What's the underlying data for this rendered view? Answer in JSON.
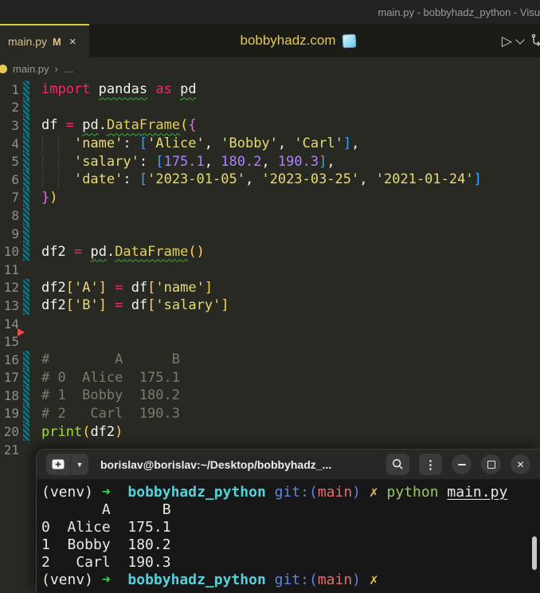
{
  "window": {
    "titlebar_text": "main.py - bobbyhadz_python - Visu"
  },
  "tab_bar": {
    "tab": {
      "name": "main.py",
      "modified_badge": "M",
      "close_glyph": "×"
    },
    "center_title": {
      "text": "bobbyhadz.com",
      "emoji": "🧊"
    },
    "actions": {
      "run_glyph": "▷"
    }
  },
  "breadcrumb": {
    "file": "main.py",
    "separator": "›",
    "more": "…"
  },
  "editor": {
    "deleted_marker_after_line": 14,
    "lines": [
      {
        "n": 1,
        "g": "m",
        "t": [
          [
            "import",
            "kw"
          ],
          [
            " ",
            "pl"
          ],
          [
            "pandas",
            "idu"
          ],
          [
            " ",
            "pl"
          ],
          [
            "as",
            "kw"
          ],
          [
            " ",
            "pl"
          ],
          [
            "pd",
            "idu"
          ]
        ]
      },
      {
        "n": 2,
        "g": "m",
        "t": []
      },
      {
        "n": 3,
        "g": "m",
        "t": [
          [
            "df ",
            "id"
          ],
          [
            "=",
            "kw"
          ],
          [
            " ",
            "pl"
          ],
          [
            "pd",
            "idu"
          ],
          [
            ".",
            "pl"
          ],
          [
            "DataFrame",
            "fnu"
          ],
          [
            "(",
            "b1"
          ],
          [
            "{",
            "b2"
          ]
        ]
      },
      {
        "n": 4,
        "g": "m",
        "t": [
          [
            "    ",
            "pl"
          ],
          [
            "'name'",
            "str"
          ],
          [
            ": ",
            "pl"
          ],
          [
            "[",
            "b3"
          ],
          [
            "'Alice'",
            "str"
          ],
          [
            ", ",
            "pl"
          ],
          [
            "'Bobby'",
            "str"
          ],
          [
            ", ",
            "pl"
          ],
          [
            "'Carl'",
            "str"
          ],
          [
            "]",
            "b3"
          ],
          [
            ",",
            "pl"
          ]
        ]
      },
      {
        "n": 5,
        "g": "m",
        "t": [
          [
            "    ",
            "pl"
          ],
          [
            "'salary'",
            "str"
          ],
          [
            ": ",
            "pl"
          ],
          [
            "[",
            "b3"
          ],
          [
            "175.1",
            "num"
          ],
          [
            ", ",
            "pl"
          ],
          [
            "180.2",
            "num"
          ],
          [
            ", ",
            "pl"
          ],
          [
            "190.3",
            "num"
          ],
          [
            "]",
            "b3"
          ],
          [
            ",",
            "pl"
          ]
        ]
      },
      {
        "n": 6,
        "g": "m",
        "t": [
          [
            "    ",
            "pl"
          ],
          [
            "'date'",
            "str"
          ],
          [
            ": ",
            "pl"
          ],
          [
            "[",
            "b3"
          ],
          [
            "'2023-01-05'",
            "str"
          ],
          [
            ", ",
            "pl"
          ],
          [
            "'2023-03-25'",
            "str"
          ],
          [
            ", ",
            "pl"
          ],
          [
            "'2021-01-24'",
            "str"
          ],
          [
            "]",
            "b3"
          ]
        ]
      },
      {
        "n": 7,
        "g": "m",
        "t": [
          [
            "}",
            "b2"
          ],
          [
            ")",
            "b1"
          ]
        ]
      },
      {
        "n": 8,
        "g": "m",
        "t": []
      },
      {
        "n": 9,
        "g": "m",
        "t": []
      },
      {
        "n": 10,
        "g": "m",
        "t": [
          [
            "df2 ",
            "id"
          ],
          [
            "=",
            "kw"
          ],
          [
            " ",
            "pl"
          ],
          [
            "pd",
            "idu"
          ],
          [
            ".",
            "pl"
          ],
          [
            "DataFrame",
            "fnu"
          ],
          [
            "(",
            "b1"
          ],
          [
            ")",
            "b1"
          ]
        ]
      },
      {
        "n": 11,
        "g": "",
        "t": []
      },
      {
        "n": 12,
        "g": "m",
        "t": [
          [
            "df2",
            "id"
          ],
          [
            "[",
            "b1"
          ],
          [
            "'A'",
            "str"
          ],
          [
            "]",
            "b1"
          ],
          [
            " ",
            "pl"
          ],
          [
            "=",
            "kw"
          ],
          [
            " ",
            "pl"
          ],
          [
            "df",
            "id"
          ],
          [
            "[",
            "b1"
          ],
          [
            "'name'",
            "str"
          ],
          [
            "]",
            "b1"
          ]
        ]
      },
      {
        "n": 13,
        "g": "m",
        "t": [
          [
            "df2",
            "id"
          ],
          [
            "[",
            "b1"
          ],
          [
            "'B'",
            "str"
          ],
          [
            "]",
            "b1"
          ],
          [
            " ",
            "pl"
          ],
          [
            "=",
            "kw"
          ],
          [
            " ",
            "pl"
          ],
          [
            "df",
            "id"
          ],
          [
            "[",
            "b1"
          ],
          [
            "'salary'",
            "str"
          ],
          [
            "]",
            "b1"
          ]
        ]
      },
      {
        "n": 14,
        "g": "",
        "t": []
      },
      {
        "n": 15,
        "g": "",
        "t": []
      },
      {
        "n": 16,
        "g": "m",
        "t": [
          [
            "#        A      B",
            "cm"
          ]
        ]
      },
      {
        "n": 17,
        "g": "m",
        "t": [
          [
            "# 0  Alice  175.1",
            "cm"
          ]
        ]
      },
      {
        "n": 18,
        "g": "m",
        "t": [
          [
            "# 1  Bobby  180.2",
            "cm"
          ]
        ]
      },
      {
        "n": 19,
        "g": "m",
        "t": [
          [
            "# 2   Carl  190.3",
            "cm"
          ]
        ]
      },
      {
        "n": 20,
        "g": "m",
        "t": [
          [
            "print",
            "fng"
          ],
          [
            "(",
            "b1"
          ],
          [
            "df2",
            "id"
          ],
          [
            ")",
            "b1"
          ]
        ]
      },
      {
        "n": 21,
        "g": "",
        "t": []
      }
    ]
  },
  "terminal": {
    "header": {
      "title": "borislav@borislav:~/Desktop/bobbyhadz_...",
      "kebab_glyph": "⋮",
      "close_glyph": "✕",
      "chevron_glyph": "▼"
    },
    "lines": [
      {
        "t": [
          [
            "(venv) ",
            "w"
          ],
          [
            "➜",
            "ar"
          ],
          [
            "  ",
            "w"
          ],
          [
            "bobbyhadz_python",
            "cy"
          ],
          [
            " ",
            "w"
          ],
          [
            "git:(",
            "bl"
          ],
          [
            "main",
            "rd"
          ],
          [
            ") ",
            "bl"
          ],
          [
            "✗",
            "yl"
          ],
          [
            " ",
            "w"
          ],
          [
            "python",
            "gn"
          ],
          [
            " ",
            "w"
          ],
          [
            "main.py",
            "wu"
          ]
        ]
      },
      {
        "t": [
          [
            "       A      B",
            "w"
          ]
        ]
      },
      {
        "t": [
          [
            "0  Alice  175.1",
            "w"
          ]
        ]
      },
      {
        "t": [
          [
            "1  Bobby  180.2",
            "w"
          ]
        ]
      },
      {
        "t": [
          [
            "2   Carl  190.3",
            "w"
          ]
        ]
      },
      {
        "t": [
          [
            "(venv) ",
            "w"
          ],
          [
            "➜",
            "ar"
          ],
          [
            "  ",
            "w"
          ],
          [
            "bobbyhadz_python",
            "cy"
          ],
          [
            " ",
            "w"
          ],
          [
            "git:(",
            "bl"
          ],
          [
            "main",
            "rd"
          ],
          [
            ") ",
            "bl"
          ],
          [
            "✗",
            "yl"
          ]
        ]
      }
    ]
  },
  "colors": {
    "accent_yellow": "#e0c64a",
    "keyword_pink": "#f92672",
    "string_yellow": "#e6db74",
    "number_purple": "#ae81ff",
    "function_green": "#a6e22e",
    "bracket_gold": "#ffd34f",
    "bracket_orchid": "#da70d6",
    "bracket_blue": "#35a4ff",
    "comment_gray": "#7d7a6a",
    "modified_gutter_teal": "#0f7c8c",
    "deleted_gutter_red": "#f14c4c",
    "terminal_cyan": "#54d2dc",
    "terminal_green": "#43d843",
    "terminal_blue": "#5e85dd",
    "terminal_red": "#e26e6e",
    "terminal_yellow": "#e2c14f"
  }
}
